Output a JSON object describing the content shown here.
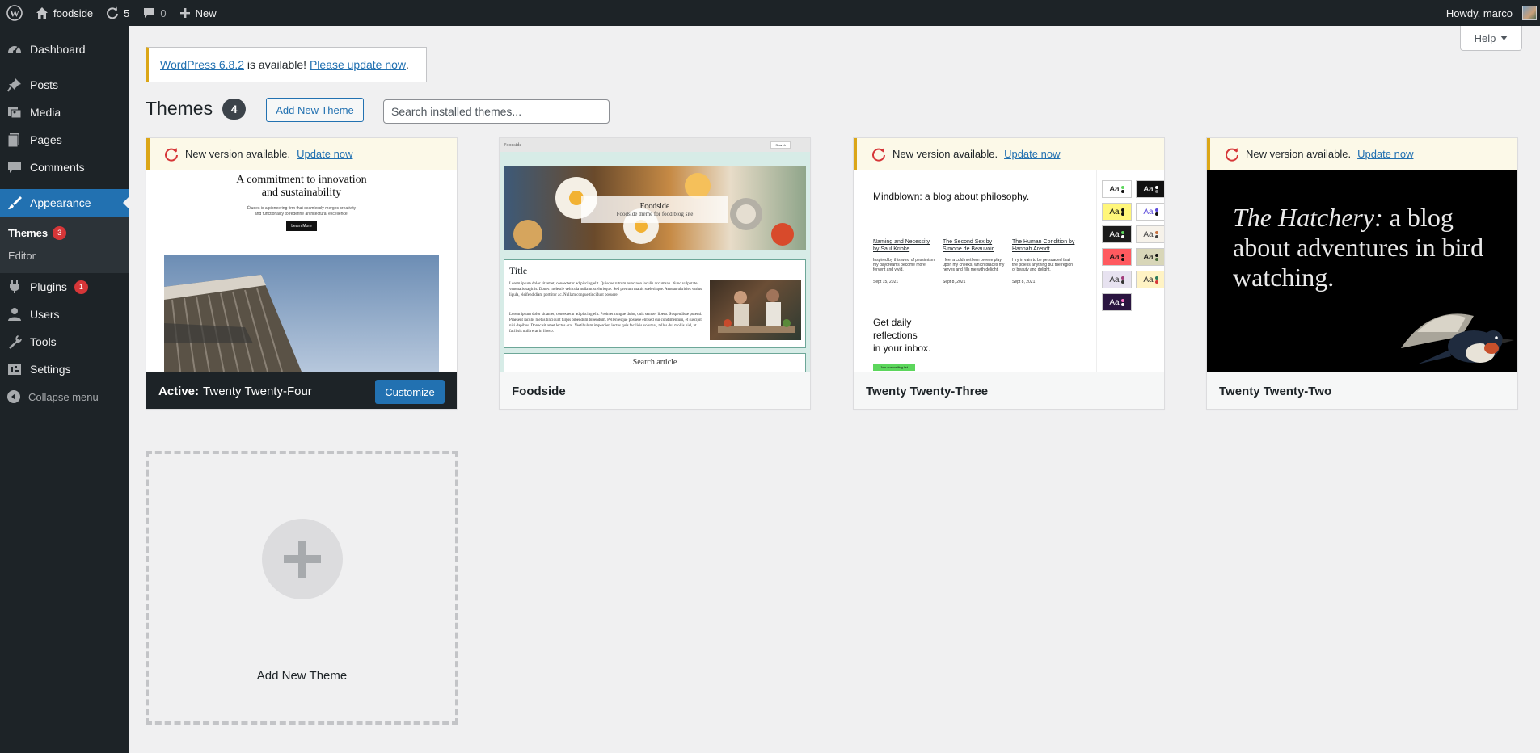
{
  "adminbar": {
    "site_name": "foodside",
    "updates_count": "5",
    "comments_count": "0",
    "new_label": "New",
    "howdy": "Howdy, marco"
  },
  "sidebar": {
    "items": [
      {
        "label": "Dashboard"
      },
      {
        "label": "Posts"
      },
      {
        "label": "Media"
      },
      {
        "label": "Pages"
      },
      {
        "label": "Comments"
      },
      {
        "label": "Appearance"
      },
      {
        "label": "Plugins",
        "badge": "1"
      },
      {
        "label": "Users"
      },
      {
        "label": "Tools"
      },
      {
        "label": "Settings"
      }
    ],
    "submenu": [
      {
        "label": "Themes",
        "badge": "3"
      },
      {
        "label": "Editor"
      }
    ],
    "collapse_label": "Collapse menu"
  },
  "help_label": "Help",
  "notice": {
    "link1": "WordPress 6.8.2",
    "middle": " is available! ",
    "link2": "Please update now",
    "end": "."
  },
  "page": {
    "title": "Themes",
    "count": "4",
    "add_button": "Add New Theme",
    "search_placeholder": "Search installed themes..."
  },
  "update_notice": {
    "text": "New version available.",
    "link": "Update now"
  },
  "themes": [
    {
      "name": "Twenty Twenty-Four",
      "active_prefix": "Active:",
      "customize_label": "Customize",
      "preview": {
        "headline_1": "A commitment to innovation",
        "headline_2": "and sustainability",
        "body_1": "Études is a pioneering firm that seamlessly merges creativity",
        "body_2": "and functionality to redefine architectural excellence.",
        "button": "Learn More"
      }
    },
    {
      "name": "Foodside",
      "preview": {
        "site": "Foodside",
        "search_btn": "Search",
        "hero_title": "Foodside",
        "hero_sub": "Foodside theme for food blog site",
        "post_title": "Title",
        "lorem": "Lorem ipsum dolor sit amet, consectetur adipiscing elit. Quisque rutrum nunc non iaculis accumsan. Nunc vulputate venenatis sagittis. Donec molestie vehicula nulla ut scelerisque. Sed pretium mattis scelerisque. Aenean ultricies varius ligula, eleifend diam porttitor ac. Nullam congue tincidunt posuere.",
        "lorem2": "Lorem ipsum dolor sit amet, consectetur adipiscing elit. Proin et congue dolor, quis semper libero. Suspendisse potenti. Praesent iaculis metus tincidunt turpis bibendum bibendum. Pellentesque posuere elit sed dui condimentum, et suscipit nisi dapibus. Donec sit amet lectus erat. Vestibulum imperdiet, lectus quis facilisis volutpat, tellus dui mollis nisl, ut facilisis nulla erat in libero.",
        "search_article": "Search article"
      }
    },
    {
      "name": "Twenty Twenty-Three",
      "preview": {
        "blog_title": "Mindblown: a blog about philosophy.",
        "posts": [
          {
            "title": "Naming and Necessity by Saul Kripke",
            "excerpt": "Inspired by this wind of pessimism, my daydreams become more fervent and vivid.",
            "date": "Sept 15, 2021"
          },
          {
            "title": "The Second Sex by Simone de Beauvoir",
            "excerpt": "I feel a cold northern breeze play upon my cheeks, which braces my nerves and fills me with delight.",
            "date": "Sept 8, 2021"
          },
          {
            "title": "The Human Condition by Hannah Arendt",
            "excerpt": "I try in vain to be persuaded that the pole is anything but the region of beauty and delight.",
            "date": "Sept 8, 2021"
          }
        ],
        "newsletter_1": "Get daily",
        "newsletter_2": "reflections",
        "newsletter_3": "in your inbox.",
        "join_label": "Join our mailing list",
        "swatch_label": "Aa"
      }
    },
    {
      "name": "Twenty Twenty-Two",
      "preview": {
        "italic": "The Hatchery:",
        "rest": " a blog about adventures in bird watching."
      }
    }
  ],
  "add_new_label": "Add New Theme",
  "colors": {
    "admin_dark": "#1d2327",
    "accent": "#2271b1",
    "warning": "#dba617",
    "badge": "#d63638"
  }
}
